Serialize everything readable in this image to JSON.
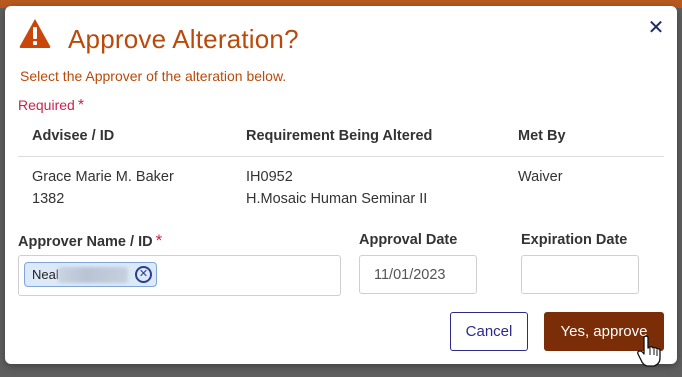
{
  "dialog": {
    "title": "Approve Alteration?",
    "subtitle": "Select the Approver of the alteration below.",
    "required_label": "Required",
    "required_marker": "*",
    "close_symbol": "✕",
    "warning_icon": "warning-triangle-icon",
    "accent_color": "#b94a0a"
  },
  "table": {
    "headers": [
      "Advisee / ID",
      "Requirement Being Altered",
      "Met By"
    ],
    "row": {
      "advisee_name": "Grace Marie M. Baker",
      "advisee_id": "1382",
      "requirement_code": "IH0952",
      "requirement_name": "H.Mosaic Human Seminar II",
      "met_by": "Waiver"
    }
  },
  "form": {
    "approver_label": "Approver Name / ID",
    "approver_chip_text": "Neal",
    "approval_date_label": "Approval Date",
    "approval_date_value": "11/01/2023",
    "expiration_date_label": "Expiration Date",
    "expiration_date_value": ""
  },
  "buttons": {
    "cancel": "Cancel",
    "approve": "Yes, approve",
    "approve_color": "#7a2d07"
  }
}
